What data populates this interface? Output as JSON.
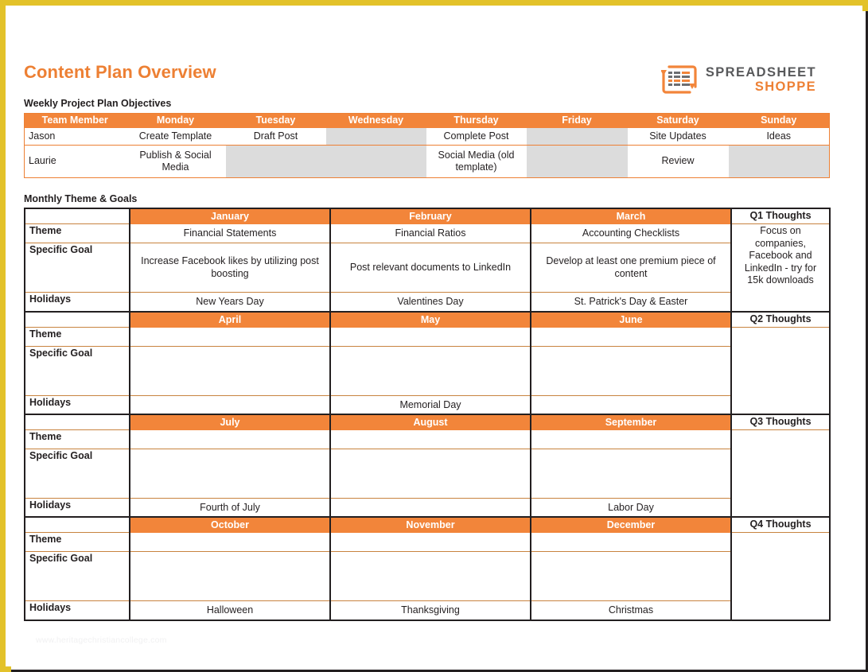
{
  "page": {
    "title": "Content Plan Overview",
    "title_color": "#ED8034",
    "accent_color": "#F2853A",
    "frame_color": "#E3C22A",
    "shaded_cell_color": "#DCDCDC",
    "watermark": "www.heritagechristiancollege.com"
  },
  "brand": {
    "logo_icon": "spreadsheet-logo-icon",
    "line1": "SPREADSHEET",
    "line2": "SHOPPE"
  },
  "weekly": {
    "section_label": "Weekly Project Plan Objectives",
    "columns": [
      "Team Member",
      "Monday",
      "Tuesday",
      "Wednesday",
      "Thursday",
      "Friday",
      "Saturday",
      "Sunday"
    ],
    "rows": [
      {
        "member": "Jason",
        "cells": [
          {
            "text": "Create Template",
            "shaded": false
          },
          {
            "text": "Draft Post",
            "shaded": false
          },
          {
            "text": "",
            "shaded": true
          },
          {
            "text": "Complete Post",
            "shaded": false
          },
          {
            "text": "",
            "shaded": true
          },
          {
            "text": "Site Updates",
            "shaded": false
          },
          {
            "text": "Ideas",
            "shaded": false
          }
        ]
      },
      {
        "member": "Laurie",
        "cells": [
          {
            "text": "Publish & Social Media",
            "shaded": false
          },
          {
            "text": "",
            "shaded": true
          },
          {
            "text": "",
            "shaded": true
          },
          {
            "text": "Social Media (old template)",
            "shaded": false
          },
          {
            "text": "",
            "shaded": true
          },
          {
            "text": "Review",
            "shaded": false
          },
          {
            "text": "",
            "shaded": true
          }
        ]
      }
    ]
  },
  "monthly": {
    "section_label": "Monthly Theme & Goals",
    "row_labels": {
      "theme": "Theme",
      "goal": "Specific Goal",
      "holidays": "Holidays"
    },
    "quarters": [
      {
        "thoughts_header": "Q1 Thoughts",
        "thoughts_text": "Focus on companies, Facebook and LinkedIn - try for 15k downloads",
        "months": [
          {
            "name": "January",
            "theme": "Financial Statements",
            "goal": "Increase Facebook likes by utilizing post boosting",
            "holiday": "New Years Day"
          },
          {
            "name": "February",
            "theme": "Financial Ratios",
            "goal": "Post relevant documents to LinkedIn",
            "holiday": "Valentines Day"
          },
          {
            "name": "March",
            "theme": "Accounting Checklists",
            "goal": "Develop at least one premium piece of content",
            "holiday": "St. Patrick's Day & Easter"
          }
        ]
      },
      {
        "thoughts_header": "Q2 Thoughts",
        "thoughts_text": "",
        "months": [
          {
            "name": "April",
            "theme": "",
            "goal": "",
            "holiday": ""
          },
          {
            "name": "May",
            "theme": "",
            "goal": "",
            "holiday": "Memorial Day"
          },
          {
            "name": "June",
            "theme": "",
            "goal": "",
            "holiday": ""
          }
        ]
      },
      {
        "thoughts_header": "Q3 Thoughts",
        "thoughts_text": "",
        "months": [
          {
            "name": "July",
            "theme": "",
            "goal": "",
            "holiday": "Fourth of July"
          },
          {
            "name": "August",
            "theme": "",
            "goal": "",
            "holiday": ""
          },
          {
            "name": "September",
            "theme": "",
            "goal": "",
            "holiday": "Labor Day"
          }
        ]
      },
      {
        "thoughts_header": "Q4 Thoughts",
        "thoughts_text": "",
        "months": [
          {
            "name": "October",
            "theme": "",
            "goal": "",
            "holiday": "Halloween"
          },
          {
            "name": "November",
            "theme": "",
            "goal": "",
            "holiday": "Thanksgiving"
          },
          {
            "name": "December",
            "theme": "",
            "goal": "",
            "holiday": "Christmas"
          }
        ]
      }
    ]
  }
}
